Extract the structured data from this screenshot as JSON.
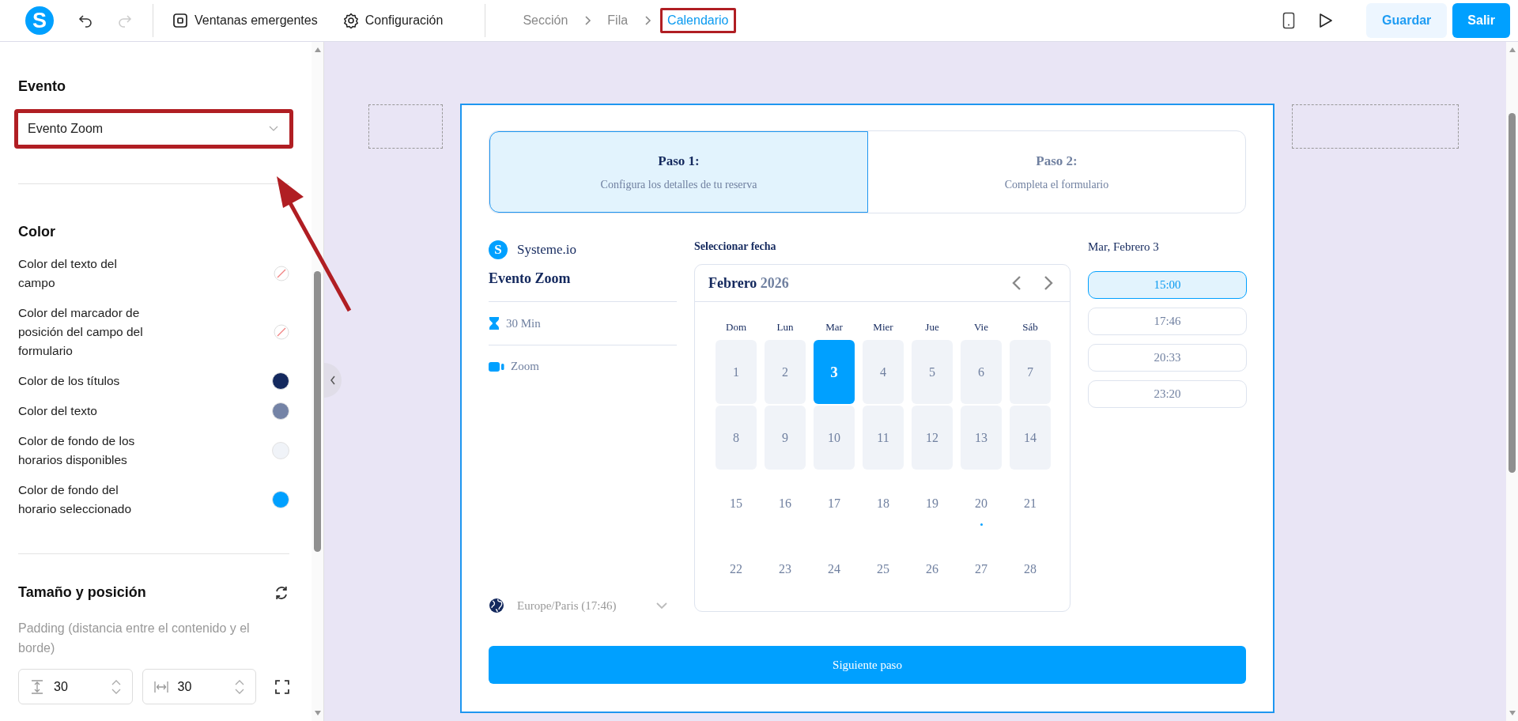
{
  "topbar": {
    "logo": "S",
    "undo_disabled": false,
    "redo_disabled": true,
    "menu": [
      {
        "kind": "popups",
        "label": "Ventanas emergentes"
      },
      {
        "kind": "settings",
        "label": "Configuración"
      }
    ],
    "breadcrumb": [
      {
        "label": "Sección",
        "selected": false,
        "highlighted": false
      },
      {
        "label": "Fila",
        "selected": false,
        "highlighted": false
      },
      {
        "label": "Calendario",
        "selected": true,
        "highlighted": true
      }
    ],
    "save": "Guardar",
    "exit": "Salir"
  },
  "sidebar": {
    "event_section": {
      "title": "Evento",
      "value": "Evento Zoom",
      "highlighted": true,
      "arrow": true
    },
    "color_section": {
      "title": "Color",
      "items": [
        {
          "label": "Color del texto del campo",
          "kind": "none"
        },
        {
          "label": "Color del marcador de posición del campo del formulario",
          "kind": "none"
        },
        {
          "label": "Color de los títulos",
          "kind": "swatch",
          "color": "#14295e"
        },
        {
          "label": "Color del texto",
          "kind": "swatch",
          "color": "#7483a6"
        },
        {
          "label": "Color de fondo de los horarios disponibles",
          "kind": "swatch",
          "color": "#f0f3f8"
        },
        {
          "label": "Color de fondo del horario seleccionado",
          "kind": "swatch",
          "color": "#00a0ff"
        }
      ]
    },
    "size_section": {
      "title": "Tamaño y posición",
      "padding_label": "Padding (distancia entre el contenido y el borde)",
      "vertical": "30",
      "horizontal": "30"
    }
  },
  "calendar_widget": {
    "steps": [
      {
        "title": "Paso 1:",
        "subtitle": "Configura los detalles de tu reserva",
        "selected": true
      },
      {
        "title": "Paso 2:",
        "subtitle": "Completa el formulario",
        "selected": false
      }
    ],
    "brand": {
      "logo": "S",
      "name": "Systeme.io"
    },
    "event_name": "Evento Zoom",
    "duration": "30 Min",
    "location": "Zoom",
    "timezone": "Europe/Paris (17:46)",
    "date_heading": "Seleccionar fecha",
    "month": "Febrero",
    "year": "2026",
    "weekdays": [
      "Dom",
      "Lun",
      "Mar",
      "Mier",
      "Jue",
      "Vie",
      "Sáb"
    ],
    "days": [
      {
        "label": "1",
        "available": true,
        "selected": false,
        "marked": false
      },
      {
        "label": "2",
        "available": true,
        "selected": false,
        "marked": false
      },
      {
        "label": "3",
        "available": true,
        "selected": true,
        "marked": false
      },
      {
        "label": "4",
        "available": true,
        "selected": false,
        "marked": false
      },
      {
        "label": "5",
        "available": true,
        "selected": false,
        "marked": false
      },
      {
        "label": "6",
        "available": true,
        "selected": false,
        "marked": false
      },
      {
        "label": "7",
        "available": true,
        "selected": false,
        "marked": false
      },
      {
        "label": "8",
        "available": true,
        "selected": false,
        "marked": false
      },
      {
        "label": "9",
        "available": true,
        "selected": false,
        "marked": false
      },
      {
        "label": "10",
        "available": true,
        "selected": false,
        "marked": false
      },
      {
        "label": "11",
        "available": true,
        "selected": false,
        "marked": false
      },
      {
        "label": "12",
        "available": true,
        "selected": false,
        "marked": false
      },
      {
        "label": "13",
        "available": true,
        "selected": false,
        "marked": false
      },
      {
        "label": "14",
        "available": true,
        "selected": false,
        "marked": false
      },
      {
        "label": "15",
        "available": false,
        "selected": false,
        "marked": false
      },
      {
        "label": "16",
        "available": false,
        "selected": false,
        "marked": false
      },
      {
        "label": "17",
        "available": false,
        "selected": false,
        "marked": false
      },
      {
        "label": "18",
        "available": false,
        "selected": false,
        "marked": false
      },
      {
        "label": "19",
        "available": false,
        "selected": false,
        "marked": false
      },
      {
        "label": "20",
        "available": false,
        "selected": false,
        "marked": true
      },
      {
        "label": "21",
        "available": false,
        "selected": false,
        "marked": false
      },
      {
        "label": "22",
        "available": false,
        "selected": false,
        "marked": false
      },
      {
        "label": "23",
        "available": false,
        "selected": false,
        "marked": false
      },
      {
        "label": "24",
        "available": false,
        "selected": false,
        "marked": false
      },
      {
        "label": "25",
        "available": false,
        "selected": false,
        "marked": false
      },
      {
        "label": "26",
        "available": false,
        "selected": false,
        "marked": false
      },
      {
        "label": "27",
        "available": false,
        "selected": false,
        "marked": false
      },
      {
        "label": "28",
        "available": false,
        "selected": false,
        "marked": false
      }
    ],
    "selected_date": "Mar, Febrero 3",
    "times": [
      {
        "label": "15:00",
        "selected": true
      },
      {
        "label": "17:46",
        "selected": false
      },
      {
        "label": "20:33",
        "selected": false
      },
      {
        "label": "23:20",
        "selected": false
      }
    ],
    "next_button": "Siguiente paso"
  }
}
